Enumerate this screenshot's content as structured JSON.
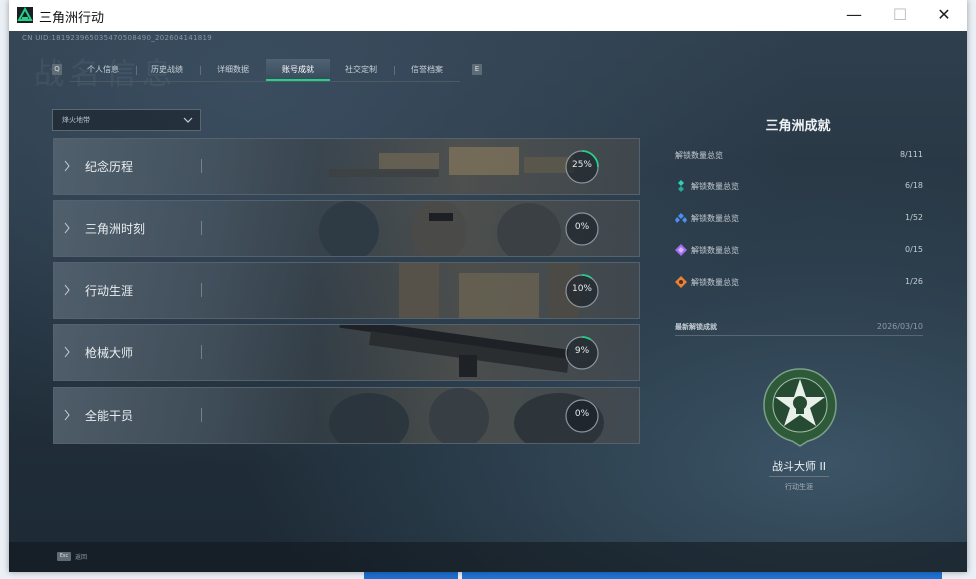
{
  "window": {
    "title": "三角洲行动",
    "minimize": "—",
    "maximize": "☐",
    "close": "✕"
  },
  "header": {
    "uid": "CN UID:181923965035470508490_202604141819",
    "watermark": "战名信息"
  },
  "tabs": {
    "prev_key": "Q",
    "next_key": "E",
    "items": [
      {
        "label": "个人信息"
      },
      {
        "label": "历史战绩"
      },
      {
        "label": "详细数据"
      },
      {
        "label": "账号成就",
        "active": true
      },
      {
        "label": "社交定制"
      },
      {
        "label": "信誉档案"
      }
    ]
  },
  "filter": {
    "selected": "烽火地带"
  },
  "categories": [
    {
      "name": "纪念历程",
      "percent": "25%",
      "value": 0.25
    },
    {
      "name": "三角洲时刻",
      "percent": "0%",
      "value": 0.0
    },
    {
      "name": "行动生涯",
      "percent": "10%",
      "value": 0.1
    },
    {
      "name": "枪械大师",
      "percent": "9%",
      "value": 0.09
    },
    {
      "name": "全能干员",
      "percent": "0%",
      "value": 0.0
    }
  ],
  "summary": {
    "title": "三角洲成就",
    "total_label": "解锁数量总览",
    "total_value": "8/111",
    "rows": [
      {
        "label": "解锁数量总览",
        "value": "6/18",
        "icon": "teal-rank-icon",
        "color": "#2fd3b4"
      },
      {
        "label": "解锁数量总览",
        "value": "1/52",
        "icon": "blue-rank-icon",
        "color": "#4b8ff0"
      },
      {
        "label": "解锁数量总览",
        "value": "0/15",
        "icon": "purple-rank-icon",
        "color": "#a56cf0"
      },
      {
        "label": "解锁数量总览",
        "value": "1/26",
        "icon": "orange-rank-icon",
        "color": "#e8823a"
      }
    ]
  },
  "latest": {
    "label": "最新解锁成就",
    "date": "2026/03/10",
    "badge_name": "战斗大师 II",
    "badge_category": "行动生涯",
    "badge_icon": "star-skull-badge-icon"
  },
  "footer": {
    "esc_key": "Esc",
    "esc_label": "返回"
  },
  "colors": {
    "accent": "#23d18b",
    "ring_track": "#8a959e",
    "ring_fill": "#23d18b"
  }
}
